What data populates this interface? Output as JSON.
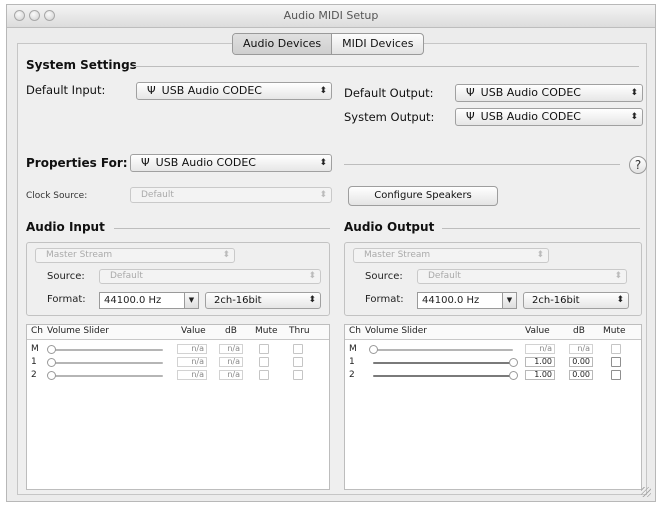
{
  "window": {
    "title": "Audio MIDI Setup"
  },
  "tabs": [
    {
      "label": "Audio Devices",
      "selected": true
    },
    {
      "label": "MIDI Devices",
      "selected": false
    }
  ],
  "system_settings": {
    "heading": "System Settings",
    "default_input_label": "Default Input:",
    "default_input_value": "USB Audio CODEC",
    "default_output_label": "Default Output:",
    "default_output_value": "USB Audio CODEC",
    "system_output_label": "System Output:",
    "system_output_value": "USB Audio CODEC"
  },
  "properties": {
    "label": "Properties For:",
    "value": "USB Audio CODEC",
    "help": "?",
    "clock_source_label": "Clock Source:",
    "clock_source_value": "Default",
    "configure_speakers": "Configure Speakers"
  },
  "audio_input": {
    "heading": "Audio Input",
    "stream": "Master Stream",
    "source_label": "Source:",
    "source_value": "Default",
    "format_label": "Format:",
    "rate": "44100.0 Hz",
    "bits": "2ch-16bit",
    "columns": {
      "ch": "Ch",
      "slider": "Volume Slider",
      "value": "Value",
      "db": "dB",
      "mute": "Mute",
      "thru": "Thru"
    },
    "rows": [
      {
        "ch": "M",
        "value": "n/a",
        "db": "n/a",
        "level": 0
      },
      {
        "ch": "1",
        "value": "n/a",
        "db": "n/a",
        "level": 0
      },
      {
        "ch": "2",
        "value": "n/a",
        "db": "n/a",
        "level": 0
      }
    ]
  },
  "audio_output": {
    "heading": "Audio Output",
    "stream": "Master Stream",
    "source_label": "Source:",
    "source_value": "Default",
    "format_label": "Format:",
    "rate": "44100.0 Hz",
    "bits": "2ch-16bit",
    "columns": {
      "ch": "Ch",
      "slider": "Volume Slider",
      "value": "Value",
      "db": "dB",
      "mute": "Mute"
    },
    "rows": [
      {
        "ch": "M",
        "value": "n/a",
        "db": "n/a",
        "level": 0
      },
      {
        "ch": "1",
        "value": "1.00",
        "db": "0.00",
        "level": 1
      },
      {
        "ch": "2",
        "value": "1.00",
        "db": "0.00",
        "level": 1
      }
    ]
  }
}
